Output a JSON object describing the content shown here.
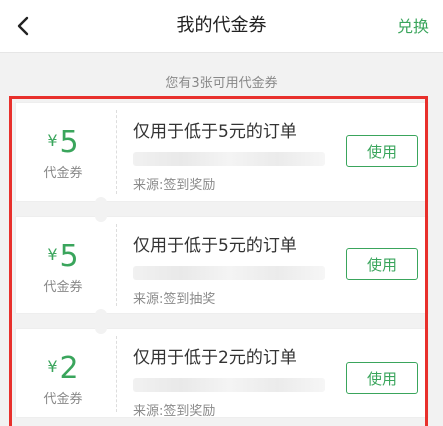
{
  "header": {
    "title": "我的代金券",
    "action_label": "兑换"
  },
  "summary": "您有3张可用代金券",
  "vouchers": [
    {
      "currency": "¥",
      "amount": "5",
      "kind": "代金券",
      "condition": "仅用于低于5元的订单",
      "source": "来源:签到奖励",
      "button": "使用"
    },
    {
      "currency": "¥",
      "amount": "5",
      "kind": "代金券",
      "condition": "仅用于低于5元的订单",
      "source": "来源:签到抽奖",
      "button": "使用"
    },
    {
      "currency": "¥",
      "amount": "2",
      "kind": "代金券",
      "condition": "仅用于低于2元的订单",
      "source": "来源:签到奖励",
      "button": "使用"
    }
  ],
  "colors": {
    "accent": "#3aa55c",
    "highlight_border": "#e8302c"
  },
  "icons": {
    "back": "chevron-left-icon"
  }
}
